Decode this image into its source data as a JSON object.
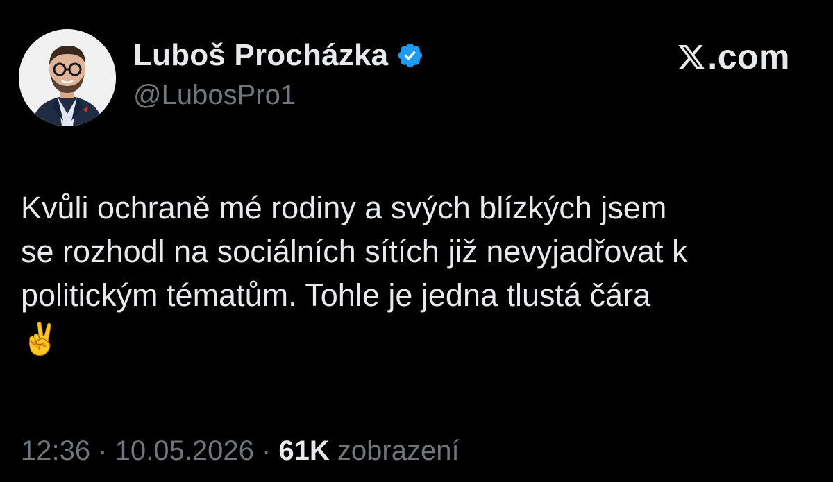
{
  "author": {
    "display_name": "Luboš Procházka",
    "handle": "@LubosPro1",
    "verified": true,
    "avatar_icon": "profile-photo"
  },
  "brand": {
    "icon": "x-logo-icon",
    "text": ".com"
  },
  "tweet": {
    "text": "Kvůli ochraně mé rodiny a svých blízkých jsem\nse rozhodl na sociálních sítích již nevyjadřovat k\npolitickým tématům. Tohle je jedna tlustá čára\n✌️"
  },
  "meta": {
    "time": "12:36",
    "separator": " · ",
    "date": "10.05.2026",
    "views_count": "61K",
    "views_label": "zobrazení"
  },
  "colors": {
    "background": "#000000",
    "primary_text": "#e7e9ea",
    "secondary_text": "#71767b",
    "verified_badge": "#1d9bf0"
  }
}
